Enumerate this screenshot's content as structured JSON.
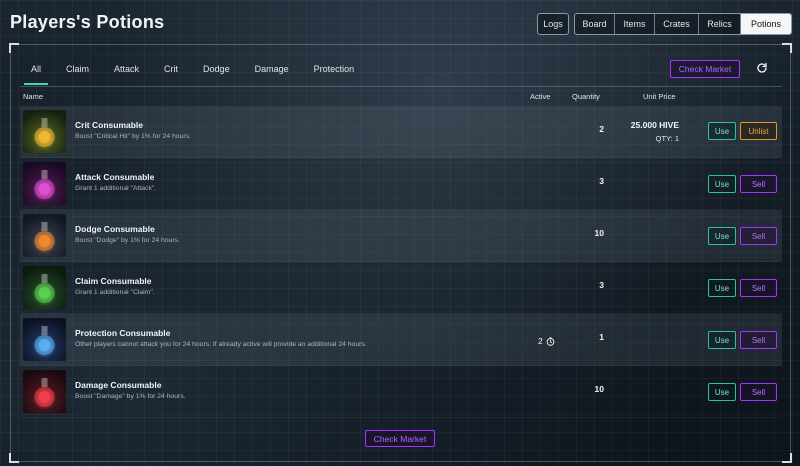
{
  "page": {
    "title": "Players's Potions"
  },
  "header": {
    "logs_label": "Logs",
    "tabs": [
      {
        "label": "Board"
      },
      {
        "label": "Items"
      },
      {
        "label": "Crates"
      },
      {
        "label": "Relics"
      },
      {
        "label": "Potions",
        "active": true
      }
    ]
  },
  "filters": [
    {
      "label": "All",
      "active": true
    },
    {
      "label": "Claim"
    },
    {
      "label": "Attack"
    },
    {
      "label": "Crit"
    },
    {
      "label": "Dodge"
    },
    {
      "label": "Damage"
    },
    {
      "label": "Protection"
    }
  ],
  "actions": {
    "check_market_label": "Check Market",
    "refresh_icon": "refresh-icon"
  },
  "table": {
    "columns": {
      "name": "Name",
      "active": "Active",
      "quantity": "Quantity",
      "unit_price": "Unit Price"
    },
    "rows": [
      {
        "name": "Crit Consumable",
        "description": "Boost \"Critical Hit\" by 1% for 24 hours.",
        "active": "",
        "quantity": "2",
        "price": "25.000 HIVE",
        "price_qty": "QTY: 1",
        "use_label": "Use",
        "secondary_label": "Unlist",
        "secondary_kind": "unlist",
        "thumb_colors": [
          "#3a4a1a",
          "#f0b832",
          "#142010"
        ]
      },
      {
        "name": "Attack Consumable",
        "description": "Grant 1 additional \"Attack\".",
        "active": "",
        "quantity": "3",
        "price": "",
        "price_qty": "",
        "use_label": "Use",
        "secondary_label": "Sell",
        "secondary_kind": "sell",
        "thumb_colors": [
          "#3a1440",
          "#e050d0",
          "#180a22"
        ]
      },
      {
        "name": "Dodge Consumable",
        "description": "Boost \"Dodge\" by 1% for 24 hours.",
        "active": "",
        "quantity": "10",
        "price": "",
        "price_qty": "",
        "use_label": "Use",
        "secondary_label": "Sell",
        "secondary_kind": "sell",
        "thumb_colors": [
          "#2a3040",
          "#f08a30",
          "#121820"
        ]
      },
      {
        "name": "Claim Consumable",
        "description": "Grant 1 additional \"Claim\".",
        "active": "",
        "quantity": "3",
        "price": "",
        "price_qty": "",
        "use_label": "Use",
        "secondary_label": "Sell",
        "secondary_kind": "sell",
        "thumb_colors": [
          "#1c3a20",
          "#5cd050",
          "#0c1a0e"
        ]
      },
      {
        "name": "Protection Consumable",
        "description": "Other players cannot attack you for 24 hours. If already active will provide an additional 24 hours.",
        "active": "2",
        "quantity": "1",
        "price": "",
        "price_qty": "",
        "use_label": "Use",
        "secondary_label": "Sell",
        "secondary_kind": "sell",
        "thumb_colors": [
          "#1a2a4a",
          "#5ab0f0",
          "#0a1222"
        ]
      },
      {
        "name": "Damage Consumable",
        "description": "Boost \"Damage\" by 1% for 24 hours.",
        "active": "",
        "quantity": "10",
        "price": "",
        "price_qty": "",
        "use_label": "Use",
        "secondary_label": "Sell",
        "secondary_kind": "sell",
        "thumb_colors": [
          "#40141a",
          "#f04050",
          "#1a0a0e"
        ]
      }
    ]
  },
  "colors": {
    "accent_teal": "#3dd6c0",
    "accent_purple": "#a335ff",
    "accent_orange": "#e0962c"
  }
}
